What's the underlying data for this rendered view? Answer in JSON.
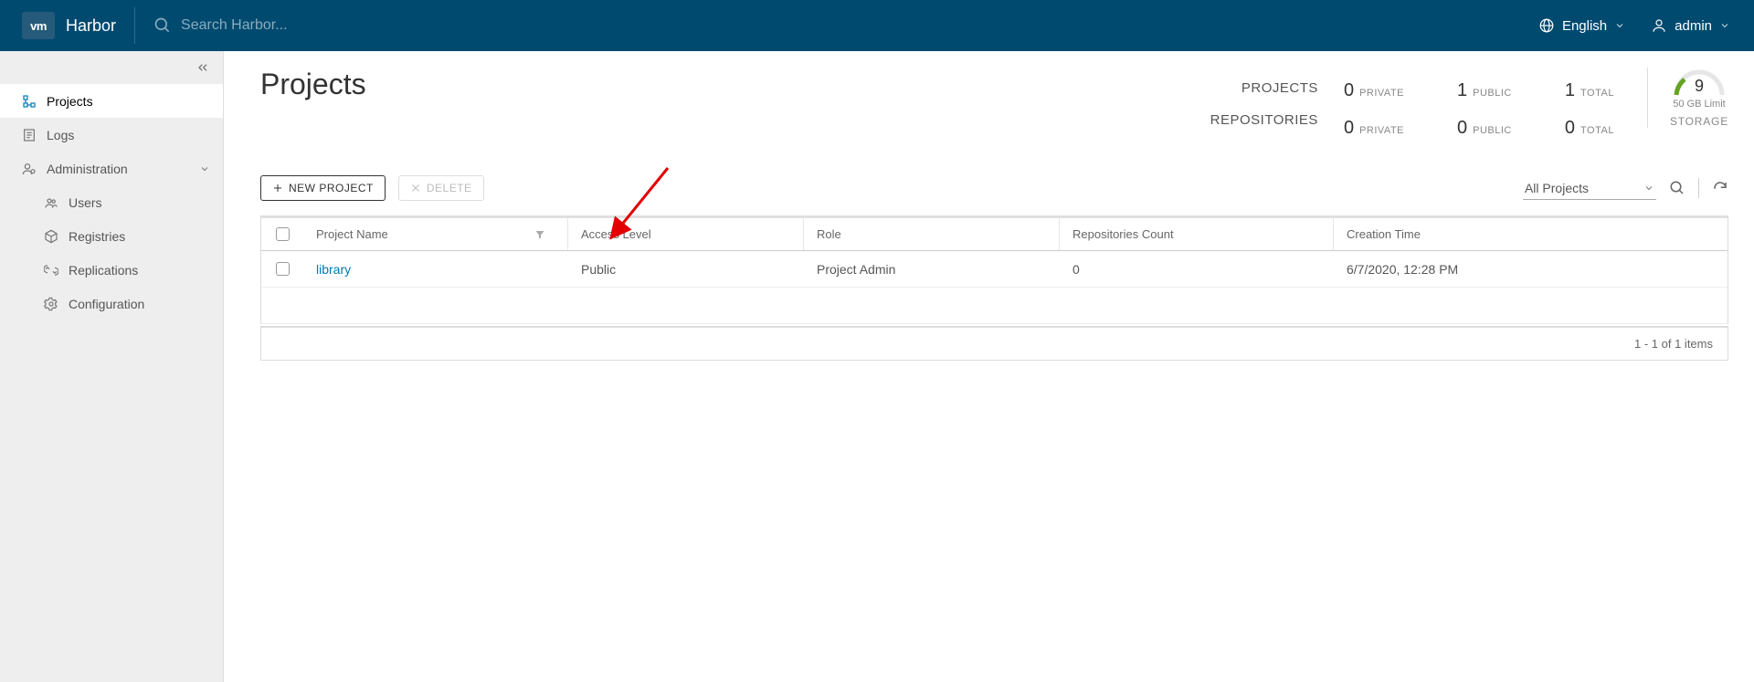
{
  "header": {
    "brand": "Harbor",
    "search_placeholder": "Search Harbor...",
    "language": "English",
    "user": "admin"
  },
  "sidebar": {
    "projects": "Projects",
    "logs": "Logs",
    "admin": "Administration",
    "users": "Users",
    "registries": "Registries",
    "replications": "Replications",
    "configuration": "Configuration"
  },
  "page": {
    "title": "Projects"
  },
  "stats": {
    "label_projects": "PROJECTS",
    "label_repos": "REPOSITORIES",
    "projects_private": "0",
    "projects_public": "1",
    "projects_total": "1",
    "repos_private": "0",
    "repos_public": "0",
    "repos_total": "0",
    "word_private": "PRIVATE",
    "word_public": "PUBLIC",
    "word_total": "TOTAL",
    "storage_value": "9",
    "storage_limit": "50 GB Limit",
    "storage_label": "STORAGE"
  },
  "toolbar": {
    "new_project": "NEW PROJECT",
    "delete": "DELETE",
    "filter": "All Projects"
  },
  "table": {
    "h_name": "Project Name",
    "h_access": "Access Level",
    "h_role": "Role",
    "h_repo": "Repositories Count",
    "h_time": "Creation Time",
    "rows": [
      {
        "name": "library",
        "access": "Public",
        "role": "Project Admin",
        "repos": "0",
        "created": "6/7/2020, 12:28 PM"
      }
    ],
    "footer": "1 - 1 of 1 items"
  }
}
